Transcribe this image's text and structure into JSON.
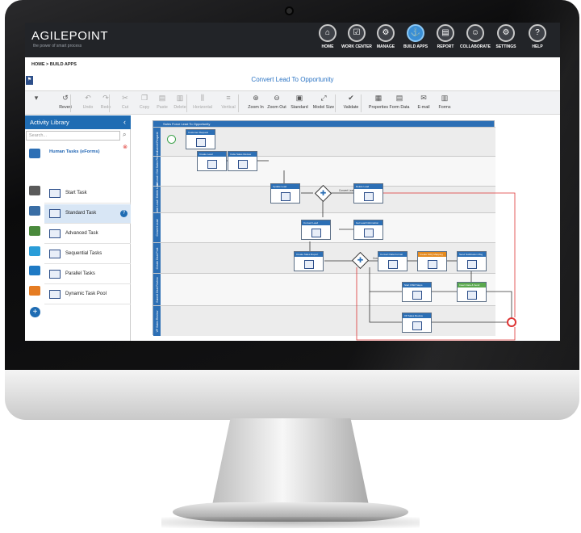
{
  "brand": {
    "name": "AGILEPOINT",
    "tagline": "the power of smart process"
  },
  "nav": [
    {
      "label": "HOME",
      "glyph": "⌂"
    },
    {
      "label": "WORK CENTER",
      "glyph": "☑"
    },
    {
      "label": "MANAGE",
      "glyph": "⚙"
    },
    {
      "label": "BUILD APPS",
      "glyph": "⚓",
      "active": true
    },
    {
      "label": "REPORT",
      "glyph": "▤"
    },
    {
      "label": "COLLABORATE",
      "glyph": "☺"
    },
    {
      "label": "SETTINGS",
      "glyph": "⚙"
    },
    {
      "label": "HELP",
      "glyph": "?"
    }
  ],
  "breadcrumb": "HOME > BUILD APPS",
  "document_title": "Convert Lead To Opportunity",
  "toolbar": [
    {
      "label": "Revert",
      "icon": "revert-icon",
      "glyph": "↺",
      "disabled": false
    },
    {
      "label": "Undo",
      "icon": "undo-icon",
      "glyph": "↶",
      "disabled": true
    },
    {
      "label": "Redo",
      "icon": "redo-icon",
      "glyph": "↷",
      "disabled": true
    },
    {
      "label": "Cut",
      "icon": "cut-icon",
      "glyph": "✂",
      "disabled": true
    },
    {
      "label": "Copy",
      "icon": "copy-icon",
      "glyph": "❐",
      "disabled": true
    },
    {
      "label": "Paste",
      "icon": "paste-icon",
      "glyph": "▤",
      "disabled": true
    },
    {
      "label": "Delete",
      "icon": "delete-icon",
      "glyph": "▥",
      "disabled": true
    },
    {
      "label": "Horizontal",
      "icon": "align-horizontal-icon",
      "glyph": "⫼",
      "disabled": true
    },
    {
      "label": "Vertical",
      "icon": "align-vertical-icon",
      "glyph": "≡",
      "disabled": true
    },
    {
      "label": "Zoom In",
      "icon": "zoom-in-icon",
      "glyph": "⊕",
      "disabled": false
    },
    {
      "label": "Zoom Out",
      "icon": "zoom-out-icon",
      "glyph": "⊖",
      "disabled": false
    },
    {
      "label": "Standard",
      "icon": "standard-icon",
      "glyph": "▣",
      "disabled": false
    },
    {
      "label": "Model Size",
      "icon": "model-size-icon",
      "glyph": "⤢",
      "disabled": false
    },
    {
      "label": "Validate",
      "icon": "validate-icon",
      "glyph": "✔",
      "disabled": false
    },
    {
      "label": "Properties",
      "icon": "properties-icon",
      "glyph": "▦",
      "disabled": false
    },
    {
      "label": "Form Data",
      "icon": "form-data-icon",
      "glyph": "▤",
      "disabled": false
    },
    {
      "label": "E-mail",
      "icon": "email-icon",
      "glyph": "✉",
      "disabled": false
    },
    {
      "label": "Forms",
      "icon": "forms-icon",
      "glyph": "▥",
      "disabled": false
    }
  ],
  "library": {
    "title": "Activity Library",
    "search_placeholder": "Search...",
    "category": "Human Tasks (eForms)",
    "items": [
      "Start Task",
      "Standard Task",
      "Advanced Task",
      "Sequential Tasks",
      "Parallel Tasks",
      "Dynamic Task Pool"
    ],
    "selected_item": "Standard Task"
  },
  "diagram": {
    "pool_title": "Sales Force Lead To Opportunity",
    "lanes": [
      "Submit Request",
      "Create Lead / Get Sales Review",
      "Update Lead / Delete Lead",
      "Convert Lead",
      "Create Deal Post",
      "Submit Deal Review",
      "VP Sales Review"
    ],
    "tasks": [
      {
        "label": "Customer Request"
      },
      {
        "label": "Create Lead"
      },
      {
        "label": "Invite Sales Review"
      },
      {
        "label": "Update Lead"
      },
      {
        "label": "Delete Lead",
        "variant": "blue"
      },
      {
        "label": "Convert Lead"
      },
      {
        "label": "Get Lead Information"
      },
      {
        "label": "Create Sales Report"
      },
      {
        "label": "Convert Data Format"
      },
      {
        "label": "Create SOQ Mapping",
        "variant": "orange"
      },
      {
        "label": "Send Notification Msg"
      },
      {
        "label": "Insert Data & Send",
        "variant": "green"
      },
      {
        "label": "Start OSM Steps"
      },
      {
        "label": "VP Sales Review"
      }
    ],
    "edge_labels": [
      "Convert Lead = No",
      "Create Or Refreshing = Yes"
    ]
  }
}
